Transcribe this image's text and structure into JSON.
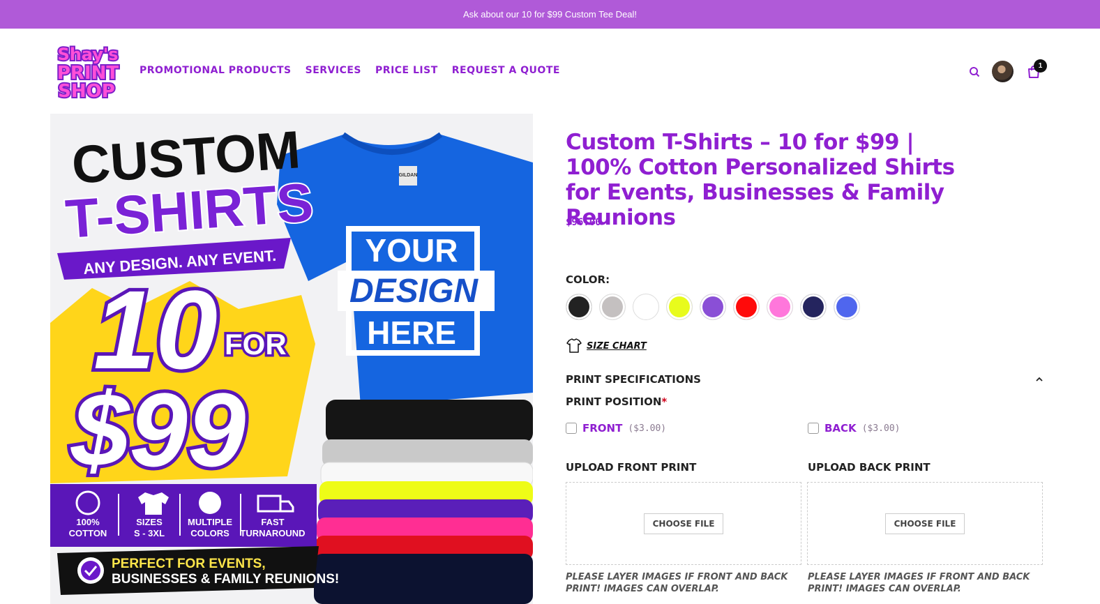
{
  "announcement": "Ask about our 10 for $99 Custom Tee Deal!",
  "logo": {
    "line1": "Shay's",
    "line2": "PRINT",
    "line3": "SHOP"
  },
  "nav": [
    "PROMOTIONAL PRODUCTS",
    "SERVICES",
    "PRICE LIST",
    "REQUEST A QUOTE"
  ],
  "cart_count": "1",
  "hero": {
    "custom": "CUSTOM",
    "tshirts": "T-SHIRTS",
    "tagline": "ANY DESIGN. ANY EVENT.",
    "ten": "10",
    "for": "FOR",
    "price": "$99",
    "your": "YOUR",
    "design": "DESIGN",
    "here": "HERE",
    "tag": "GILDAN",
    "features": [
      {
        "l1": "100%",
        "l2": "COTTON"
      },
      {
        "l1": "SIZES",
        "l2": "S - 3XL"
      },
      {
        "l1": "MULTIPLE",
        "l2": "COLORS"
      },
      {
        "l1": "FAST",
        "l2": "TURNAROUND"
      }
    ],
    "perfect1": "PERFECT FOR EVENTS,",
    "perfect2": "BUSINESSES & FAMILY REUNIONS!"
  },
  "product": {
    "title": "Custom T-Shirts – 10 for $99 | 100% Cotton Personalized Shirts for Events, Businesses & Family Reunions",
    "price": "$96.00",
    "color_label": "COLOR:",
    "colors": [
      "#222222",
      "#c4c0c0",
      "#ffffff",
      "#e8fb1c",
      "#8a4fd6",
      "#ff0a0a",
      "#ff77db",
      "#24245e",
      "#4f66ee"
    ],
    "size_chart": "SIZE CHART",
    "spec_title": "PRINT SPECIFICATIONS",
    "position_label": "PRINT POSITION",
    "required": "*",
    "front": {
      "name": "FRONT",
      "cost": "($3.00)"
    },
    "back": {
      "name": "BACK",
      "cost": "($3.00)"
    },
    "upload_front": "UPLOAD FRONT PRINT",
    "upload_back": "UPLOAD BACK PRINT",
    "choose_file": "CHOOSE FILE",
    "note": "PLEASE LAYER IMAGES IF FRONT AND BACK PRINT! IMAGES CAN OVERLAP."
  }
}
